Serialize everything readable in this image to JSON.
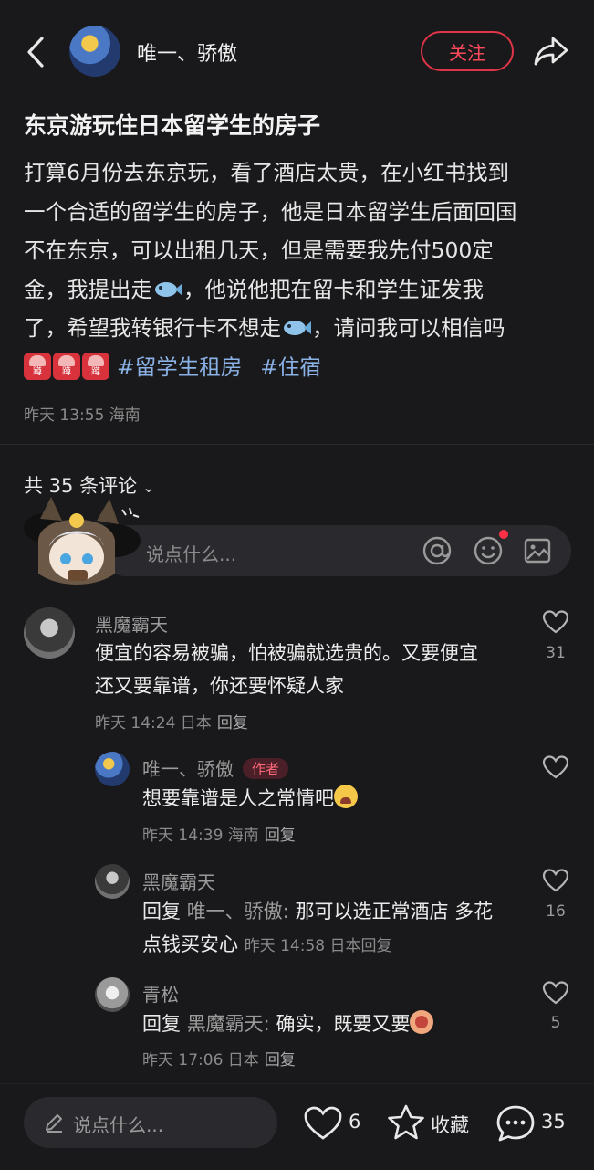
{
  "header": {
    "author_name": "唯一、骄傲",
    "follow_label": "关注"
  },
  "post": {
    "title": "东京游玩住日本留学生的房子",
    "body_lines": [
      "打算6月份去东京玩，看了酒店太贵，在小红书找到",
      "一个合适的留学生的房子，他是日本留学生后面回国",
      "不在东京，可以出租几天，但是需要我先付500定",
      "金，我提出走",
      "，他说他把在留卡和学生证发我",
      "了，希望我转银行卡不想走",
      "，请问我可以相信吗"
    ],
    "tags": [
      "#留学生租房",
      "#住宿"
    ],
    "meta": "昨天 13:55 海南"
  },
  "comments_section": {
    "count_label": "共 35 条评论",
    "input_placeholder": "说点什么..."
  },
  "comments": [
    {
      "name": "黑魔霸天",
      "text_lines": [
        "便宜的容易被骗，怕被骗就选贵的。又要便宜",
        "还又要靠谱，你还要怀疑人家"
      ],
      "meta": "昨天 14:24 日本",
      "reply_label": "回复",
      "likes": "31"
    },
    {
      "name": "唯一、骄傲",
      "badge": "作者",
      "text": "想要靠谱是人之常情吧",
      "meta": "昨天 14:39 海南",
      "reply_label": "回复",
      "likes": ""
    },
    {
      "name": "黑魔霸天",
      "reply_prefix": "回复",
      "reply_to": "唯一、骄傲:",
      "text_line1": " 那可以选正常酒店 多花",
      "text_line2": "点钱买安心",
      "meta": "昨天 14:58 日本",
      "reply_label": "回复",
      "likes": "16"
    },
    {
      "name": "青松",
      "reply_prefix": "回复",
      "reply_to": "黑魔霸天:",
      "text": " 确实，既要又要",
      "meta": "昨天 17:06 日本",
      "reply_label": "回复",
      "likes": "5"
    }
  ],
  "bottom_bar": {
    "placeholder": "说点什么...",
    "likes": "6",
    "favorite_label": "收藏",
    "comments": "35"
  }
}
